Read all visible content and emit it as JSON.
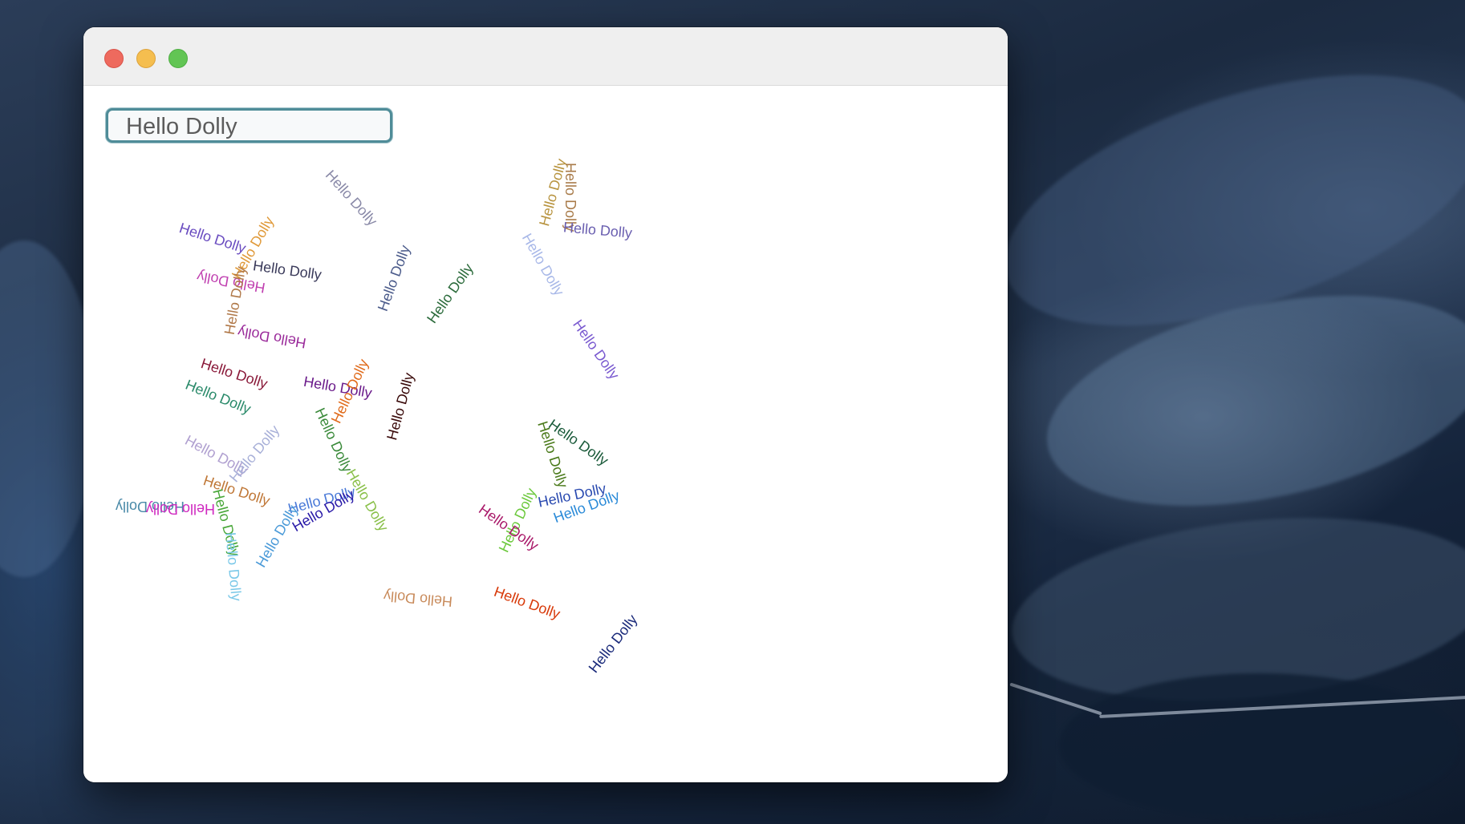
{
  "input": {
    "value": "Hello Dolly",
    "border_color": "#4f8c98"
  },
  "window_controls": {
    "close_color": "#ee6a5e",
    "minimize_color": "#f5be4f",
    "zoom_color": "#62c554"
  },
  "scattered_text": [
    {
      "text": "Hello Dolly",
      "color": "#8a8aa8"
    },
    {
      "text": "Hello Dolly",
      "color": "#b89440"
    },
    {
      "text": "Hello Dolly",
      "color": "#a87a48"
    },
    {
      "text": "Hello Dolly",
      "color": "#6a5fb0"
    },
    {
      "text": "Hello Dolly",
      "color": "#6a4cc0"
    },
    {
      "text": "Hello Dolly",
      "color": "#e09a3a"
    },
    {
      "text": "Hello Dolly",
      "color": "#3a3a5a"
    },
    {
      "text": "Hello Dolly",
      "color": "#c040b0"
    },
    {
      "text": "Hello Dolly",
      "color": "#b07848"
    },
    {
      "text": "Hello Dolly",
      "color": "#4a5a8a"
    },
    {
      "text": "Hello Dolly",
      "color": "#2a6a3a"
    },
    {
      "text": "Hello Dolly",
      "color": "#a8b8e8"
    },
    {
      "text": "Hello Dolly",
      "color": "#9a2a9a"
    },
    {
      "text": "Hello Dolly",
      "color": "#7a5ad0"
    },
    {
      "text": "Hello Dolly",
      "color": "#8a1a3a"
    },
    {
      "text": "Hello Dolly",
      "color": "#6a1a8a"
    },
    {
      "text": "Hello Dolly",
      "color": "#e06a1a"
    },
    {
      "text": "Hello Dolly",
      "color": "#3a0a0a"
    },
    {
      "text": "Hello Dolly",
      "color": "#2a8a6a"
    },
    {
      "text": "Hello Dolly",
      "color": "#3a8a3a"
    },
    {
      "text": "Hello Dolly",
      "color": "#1a5a3a"
    },
    {
      "text": "Hello Dolly",
      "color": "#4a7a1a"
    },
    {
      "text": "Hello Dolly",
      "color": "#b0a0d0"
    },
    {
      "text": "Hello Dolly",
      "color": "#a8b0d8"
    },
    {
      "text": "Hello Dolly",
      "color": "#c07838"
    },
    {
      "text": "Hello Dolly",
      "color": "#8ac04a"
    },
    {
      "text": "Hello Dolly",
      "color": "#4a8aa8"
    },
    {
      "text": "Hello Dolly",
      "color": "#d02ac0"
    },
    {
      "text": "Hello Dolly",
      "color": "#4aa83a"
    },
    {
      "text": "Hello Dolly",
      "color": "#4a7ad8"
    },
    {
      "text": "Hello Dolly",
      "color": "#2a1aa8"
    },
    {
      "text": "Hello Dolly",
      "color": "#4a9ad8"
    },
    {
      "text": "Hello Dolly",
      "color": "#2a4ab0"
    },
    {
      "text": "Hello Dolly",
      "color": "#2a8ad8"
    },
    {
      "text": "Hello Dolly",
      "color": "#6ac83a"
    },
    {
      "text": "Hello Dolly",
      "color": "#aa1a6a"
    },
    {
      "text": "Hello Dolly",
      "color": "#7ac8e8"
    },
    {
      "text": "Hello Dolly",
      "color": "#c88a5a"
    },
    {
      "text": "Hello Dolly",
      "color": "#d83a0a"
    },
    {
      "text": "Hello Dolly",
      "color": "#1a2a7a"
    }
  ]
}
